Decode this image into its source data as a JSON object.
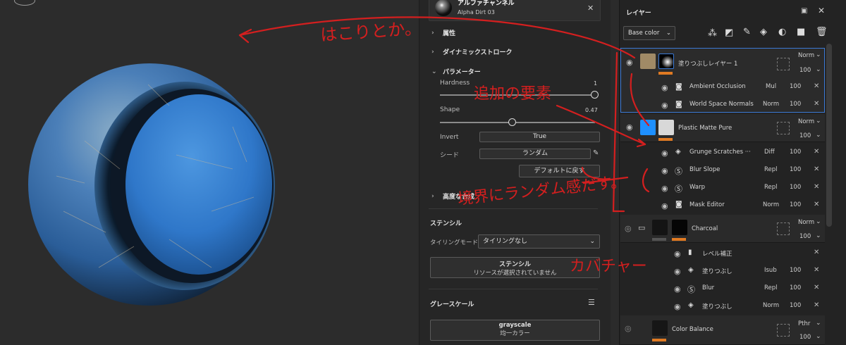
{
  "props": {
    "alpha_title": "アルファチャンネル",
    "alpha_sub": "Alpha Dirt 03",
    "sec_attr": "属性",
    "sec_dyn": "ダイナミックストローク",
    "sec_param": "パラメーター",
    "hardness_label": "Hardness",
    "hardness_value": "1",
    "hardness": 1.0,
    "shape_label": "Shape",
    "shape_value": "0.47",
    "shape": 0.47,
    "invert_label": "Invert",
    "invert_value": "True",
    "seed_label": "シード",
    "seed_value": "ランダム",
    "reset_label": "デフォルトに戻す",
    "sec_adv": "高度な合成",
    "stencil_header": "ステンシル",
    "tiling_label": "タイリングモード",
    "tiling_value": "タイリングなし",
    "stencil_btn_title": "ステンシル",
    "stencil_btn_sub": "リソースが選択されていません",
    "gray_header": "グレースケール",
    "gray_btn_title": "grayscale",
    "gray_btn_sub": "均一カラー"
  },
  "layers": {
    "title": "レイヤー",
    "channel": "Base color",
    "rows": [
      {
        "name": "塗りつぶしレイヤー 1",
        "blend": "Norm",
        "opacity": "100"
      },
      {
        "name": "Ambient Occlusion",
        "blend": "Mul",
        "opacity": "100"
      },
      {
        "name": "World Space Normals",
        "blend": "Norm",
        "opacity": "100"
      },
      {
        "name": "Plastic Matte Pure",
        "blend": "Norm",
        "opacity": "100"
      },
      {
        "name": "Grunge Scratches ···",
        "blend": "Diff",
        "opacity": "100"
      },
      {
        "name": "Blur Slope",
        "blend": "Repl",
        "opacity": "100"
      },
      {
        "name": "Warp",
        "blend": "Repl",
        "opacity": "100"
      },
      {
        "name": "Mask Editor",
        "blend": "Norm",
        "opacity": "100"
      },
      {
        "name": "Charcoal",
        "blend": "Norm",
        "opacity": "100"
      },
      {
        "name": "レベル補正",
        "blend": "",
        "opacity": ""
      },
      {
        "name": "塗りつぶし",
        "blend": "Isub",
        "opacity": "100"
      },
      {
        "name": "Blur",
        "blend": "Repl",
        "opacity": "100"
      },
      {
        "name": "塗りつぶし",
        "blend": "Norm",
        "opacity": "100"
      },
      {
        "name": "Color Balance",
        "blend": "Pthr",
        "opacity": "100"
      }
    ]
  },
  "annotations": {
    "note1": "はこりとか。",
    "note2": "追加の要素",
    "note3": "境界にランダム感だす。",
    "note4": "カバチャー"
  },
  "colors": {
    "accent": "#e07a22",
    "select": "#3b7ad6",
    "ink": "#d41f1f",
    "sphere": "#2f77c9"
  }
}
